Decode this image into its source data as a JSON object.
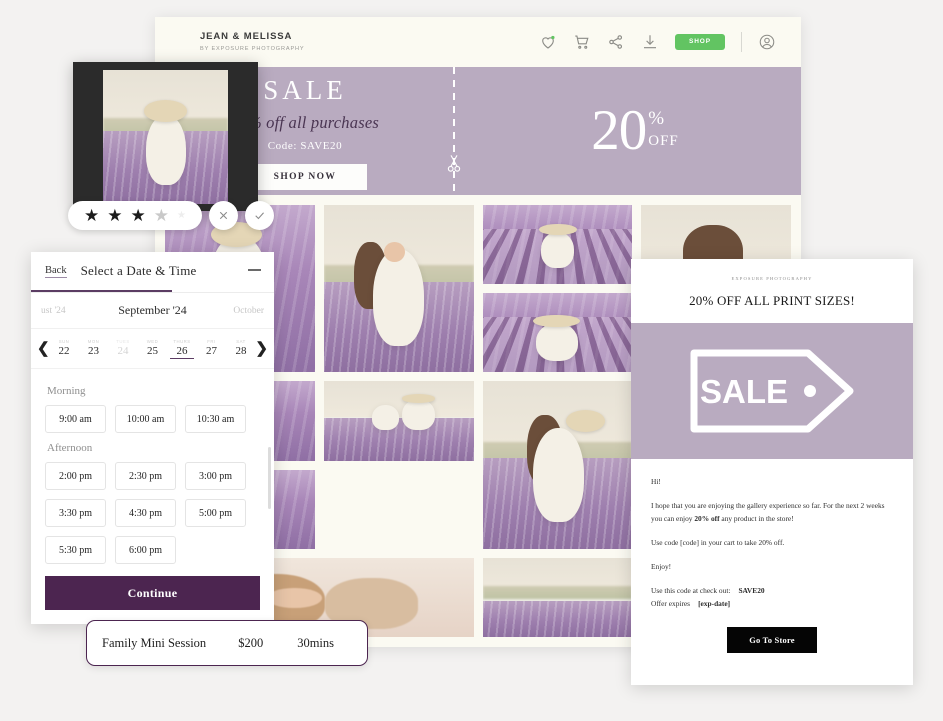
{
  "gallery": {
    "brand_name": "JEAN & MELISSA",
    "brand_sub": "BY EXPOSURE PHOTOGRAPHY",
    "actions": {
      "favorite_icon": "heart-icon",
      "cart_icon": "shopping-cart-icon",
      "share_icon": "share-icon",
      "download_icon": "download-icon",
      "shop_label": "SHOP",
      "account_icon": "account-icon"
    }
  },
  "banner": {
    "title": "SALE",
    "subtitle": "20% off all purchases",
    "code_line": "Code: SAVE20",
    "cta_label": "SHOP NOW",
    "percent_number": "20",
    "percent_symbol": "%",
    "percent_off": "OFF",
    "scissors_icon": "scissors-icon",
    "background_color": "#b9abc0"
  },
  "preview": {
    "rating_stars": [
      "filled",
      "filled",
      "filled",
      "dim",
      "faint"
    ],
    "reject_icon": "close-icon",
    "accept_icon": "check-icon"
  },
  "booking": {
    "back_label": "Back",
    "title": "Select a Date & Time",
    "minimize_icon": "minimize-icon",
    "months": {
      "prev": "ust '24",
      "current": "September '24",
      "next": "October"
    },
    "prev_arrow_icon": "chevron-left-icon",
    "next_arrow_icon": "chevron-right-icon",
    "days": [
      {
        "dow": "SUN",
        "num": "22",
        "state": "enabled"
      },
      {
        "dow": "MON",
        "num": "23",
        "state": "enabled"
      },
      {
        "dow": "TUES",
        "num": "24",
        "state": "disabled"
      },
      {
        "dow": "WED",
        "num": "25",
        "state": "enabled"
      },
      {
        "dow": "THURS",
        "num": "26",
        "state": "selected"
      },
      {
        "dow": "FRI",
        "num": "27",
        "state": "enabled"
      },
      {
        "dow": "SAT",
        "num": "28",
        "state": "enabled"
      }
    ],
    "morning_label": "Morning",
    "morning_slots": [
      "9:00 am",
      "10:00 am",
      "10:30 am"
    ],
    "afternoon_label": "Afternoon",
    "afternoon_slots": [
      "2:00 pm",
      "2:30 pm",
      "3:00 pm",
      "3:30 pm",
      "4:30 pm",
      "5:00 pm",
      "5:30 pm",
      "6:00 pm"
    ],
    "continue_label": "Continue",
    "accent_color": "#4c2550"
  },
  "session": {
    "name": "Family Mini Session",
    "price": "$200",
    "duration": "30mins"
  },
  "email": {
    "brand": "EXPOSURE PHOTOGRAPHY",
    "title": "20% OFF ALL PRINT SIZES!",
    "tag_text": "SALE",
    "greeting": "Hi!",
    "paragraph_1_a": "I hope that you are enjoying the gallery experience so far. For the next 2 weeks you can enjoy ",
    "paragraph_1_b": "20% off",
    "paragraph_1_c": " any product in the store!",
    "paragraph_2": "Use code [code] in your cart to take 20% off.",
    "paragraph_3": "Enjoy!",
    "checkout_label": "Use this code at check out:",
    "checkout_code": "SAVE20",
    "expires_label": "Offer expires",
    "expires_value": "[exp-date]",
    "button_label": "Go To Store",
    "hero_color": "#b9abc0"
  }
}
